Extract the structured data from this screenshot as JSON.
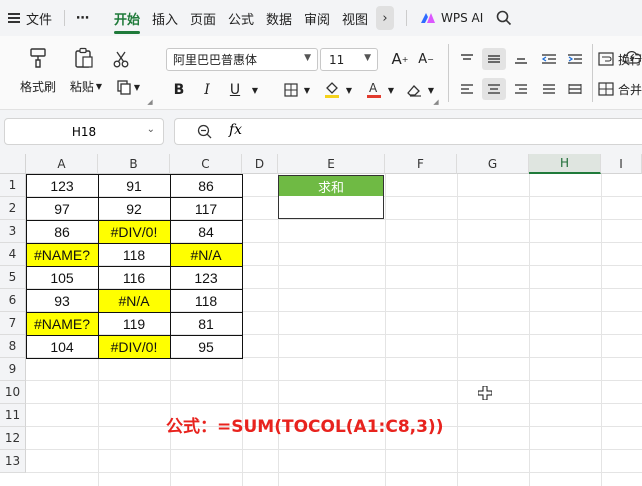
{
  "menu": {
    "file": "文件",
    "more_dots": "⋯",
    "tabs": [
      "开始",
      "插入",
      "页面",
      "公式",
      "数据",
      "审阅",
      "视图"
    ],
    "more_arrow": "›",
    "wps_ai": "WPS AI"
  },
  "ribbon": {
    "format_painter": "格式刷",
    "paste": "粘贴",
    "font_name": "阿里巴巴普惠体",
    "font_size": "11",
    "wrap": "换行",
    "merge": "合并"
  },
  "formula_bar": {
    "name_box": "H18",
    "fx": "fx",
    "formula": ""
  },
  "colors": {
    "accent": "#1f7a3a",
    "error_fill": "#ffff00",
    "sum_header_fill": "#6fba44",
    "note_color": "#e8231e"
  },
  "sheet": {
    "columns": [
      "A",
      "B",
      "C",
      "D",
      "E",
      "F",
      "G",
      "H",
      "I"
    ],
    "rows": [
      "1",
      "2",
      "3",
      "4",
      "5",
      "6",
      "7",
      "8",
      "9",
      "10",
      "11",
      "12",
      "13"
    ],
    "selected_column": "H",
    "table": [
      [
        "123",
        "91",
        "86"
      ],
      [
        "97",
        "92",
        "117"
      ],
      [
        "86",
        "#DIV/0!",
        "84"
      ],
      [
        "#NAME?",
        "118",
        "#N/A"
      ],
      [
        "105",
        "116",
        "123"
      ],
      [
        "93",
        "#N/A",
        "118"
      ],
      [
        "#NAME?",
        "119",
        "81"
      ],
      [
        "104",
        "#DIV/0!",
        "95"
      ]
    ],
    "sum_header": "求和",
    "sum_value": "",
    "formula_note": "公式：=SUM(TOCOL(A1:C8,3))"
  }
}
